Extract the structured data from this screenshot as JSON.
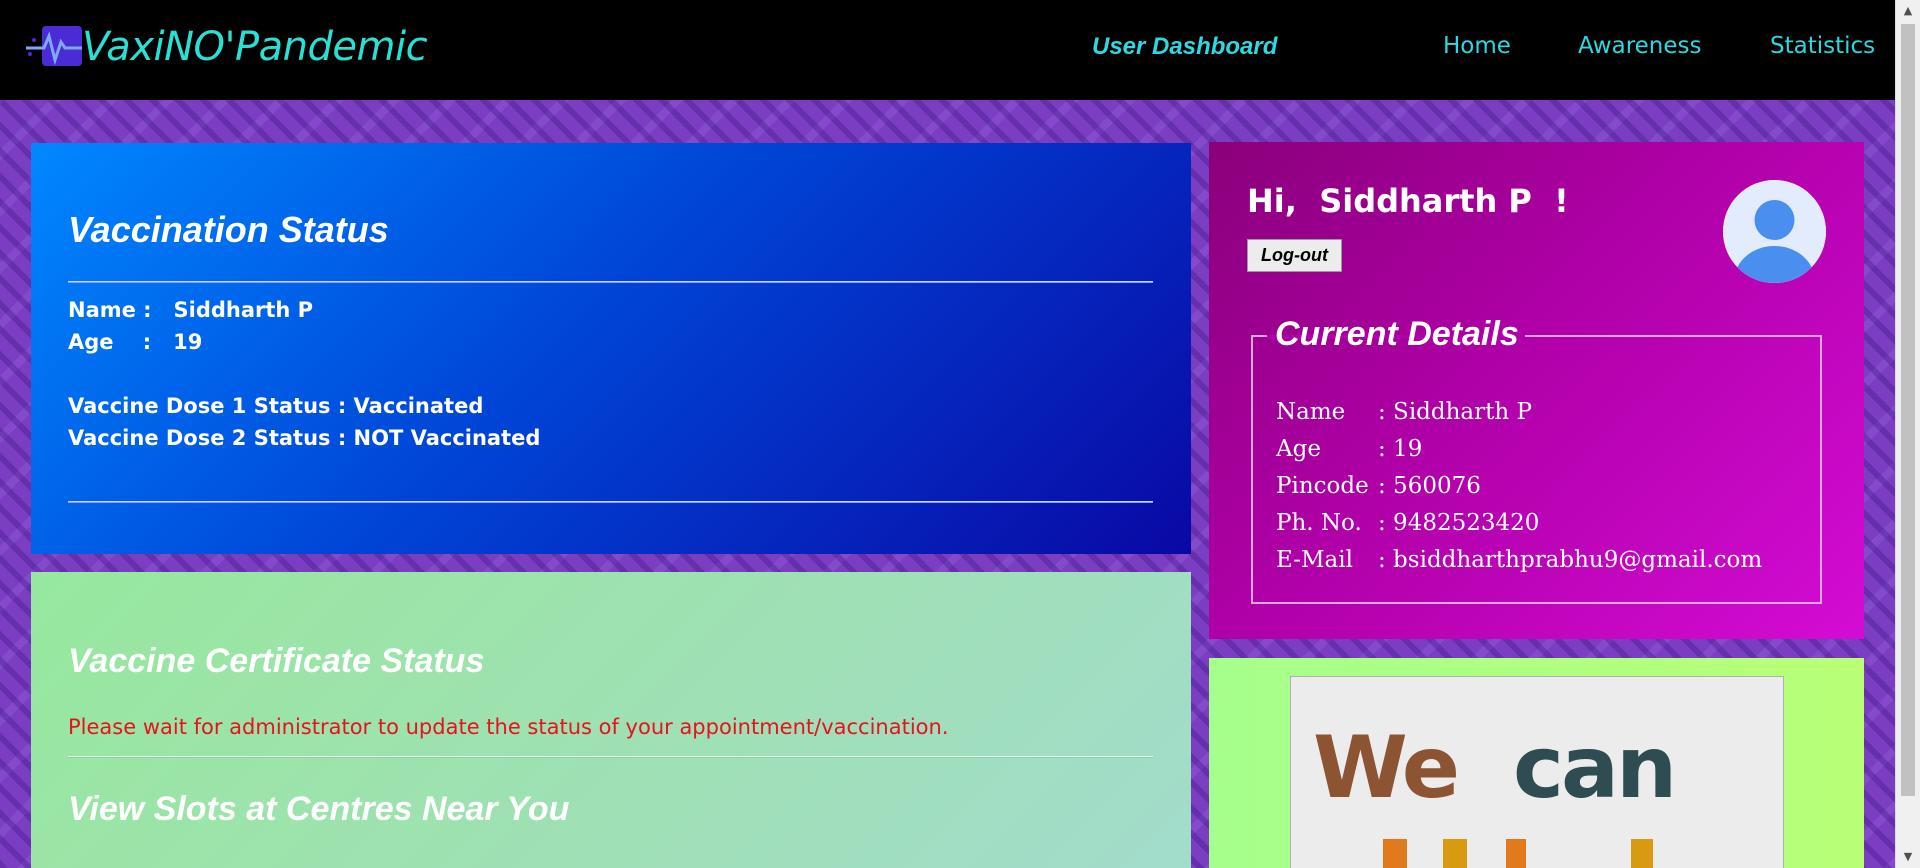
{
  "nav": {
    "brand": "VaxiNO'Pandemic",
    "dashboard_label": "User Dashboard",
    "links": [
      "Home",
      "Awareness",
      "Statistics"
    ]
  },
  "vaccination": {
    "title": "Vaccination Status",
    "name_line": "Name :   Siddharth P",
    "age_line": "Age    :   19",
    "dose1_line": "Vaccine Dose 1 Status : Vaccinated",
    "dose2_line": "Vaccine Dose 2 Status : NOT Vaccinated"
  },
  "certificate": {
    "title": "Vaccine Certificate Status",
    "message": "Please wait for administrator to update the status of your appointment/vaccination.",
    "slots_title": "View Slots at Centres Near You"
  },
  "profile": {
    "greeting": "Hi,  Siddharth P  !",
    "logout_label": "Log-out",
    "details_title": "Current Details",
    "details": [
      {
        "label": "Name",
        "value": ": Siddharth P"
      },
      {
        "label": "Age",
        "value": ": 19"
      },
      {
        "label": "Pincode",
        "value": ": 560076"
      },
      {
        "label": "Ph. No.",
        "value": ": 9482523420"
      },
      {
        "label": "E-Mail",
        "value": ": bsiddharthprabhu9@gmail.com"
      }
    ]
  },
  "banner": {
    "word1": "We",
    "word2": "can"
  },
  "colors": {
    "nav_text": "#2fd8e0",
    "warning": "#e8121c"
  }
}
